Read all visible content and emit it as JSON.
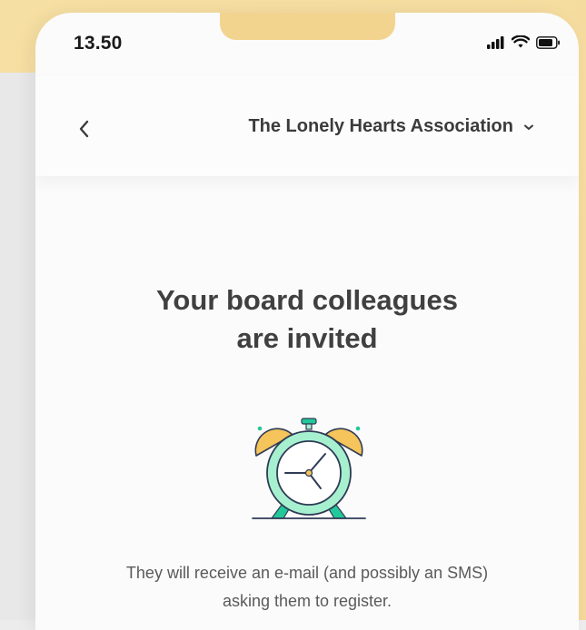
{
  "status_bar": {
    "time": "13.50",
    "icons": [
      "signal-icon",
      "wifi-icon",
      "battery-icon"
    ]
  },
  "nav": {
    "back_icon": "chevron-left-icon",
    "organization_name": "The Lonely Hearts Association",
    "dropdown_icon": "chevron-down-icon"
  },
  "content": {
    "title_line_1": "Your board colleagues",
    "title_line_2": "are invited",
    "illustration": "alarm-clock-icon",
    "message_line_1": "They will receive an e-mail (and possibly an SMS)",
    "message_line_2": "asking them to register."
  },
  "colors": {
    "background_accent": "#f6dfa3",
    "clock_body": "#a6f0cf",
    "clock_bells": "#f5c45a",
    "clock_outline": "#2f3b55",
    "clock_legs": "#23c89a",
    "text_primary": "#404040",
    "text_secondary": "#5a5a5a"
  }
}
